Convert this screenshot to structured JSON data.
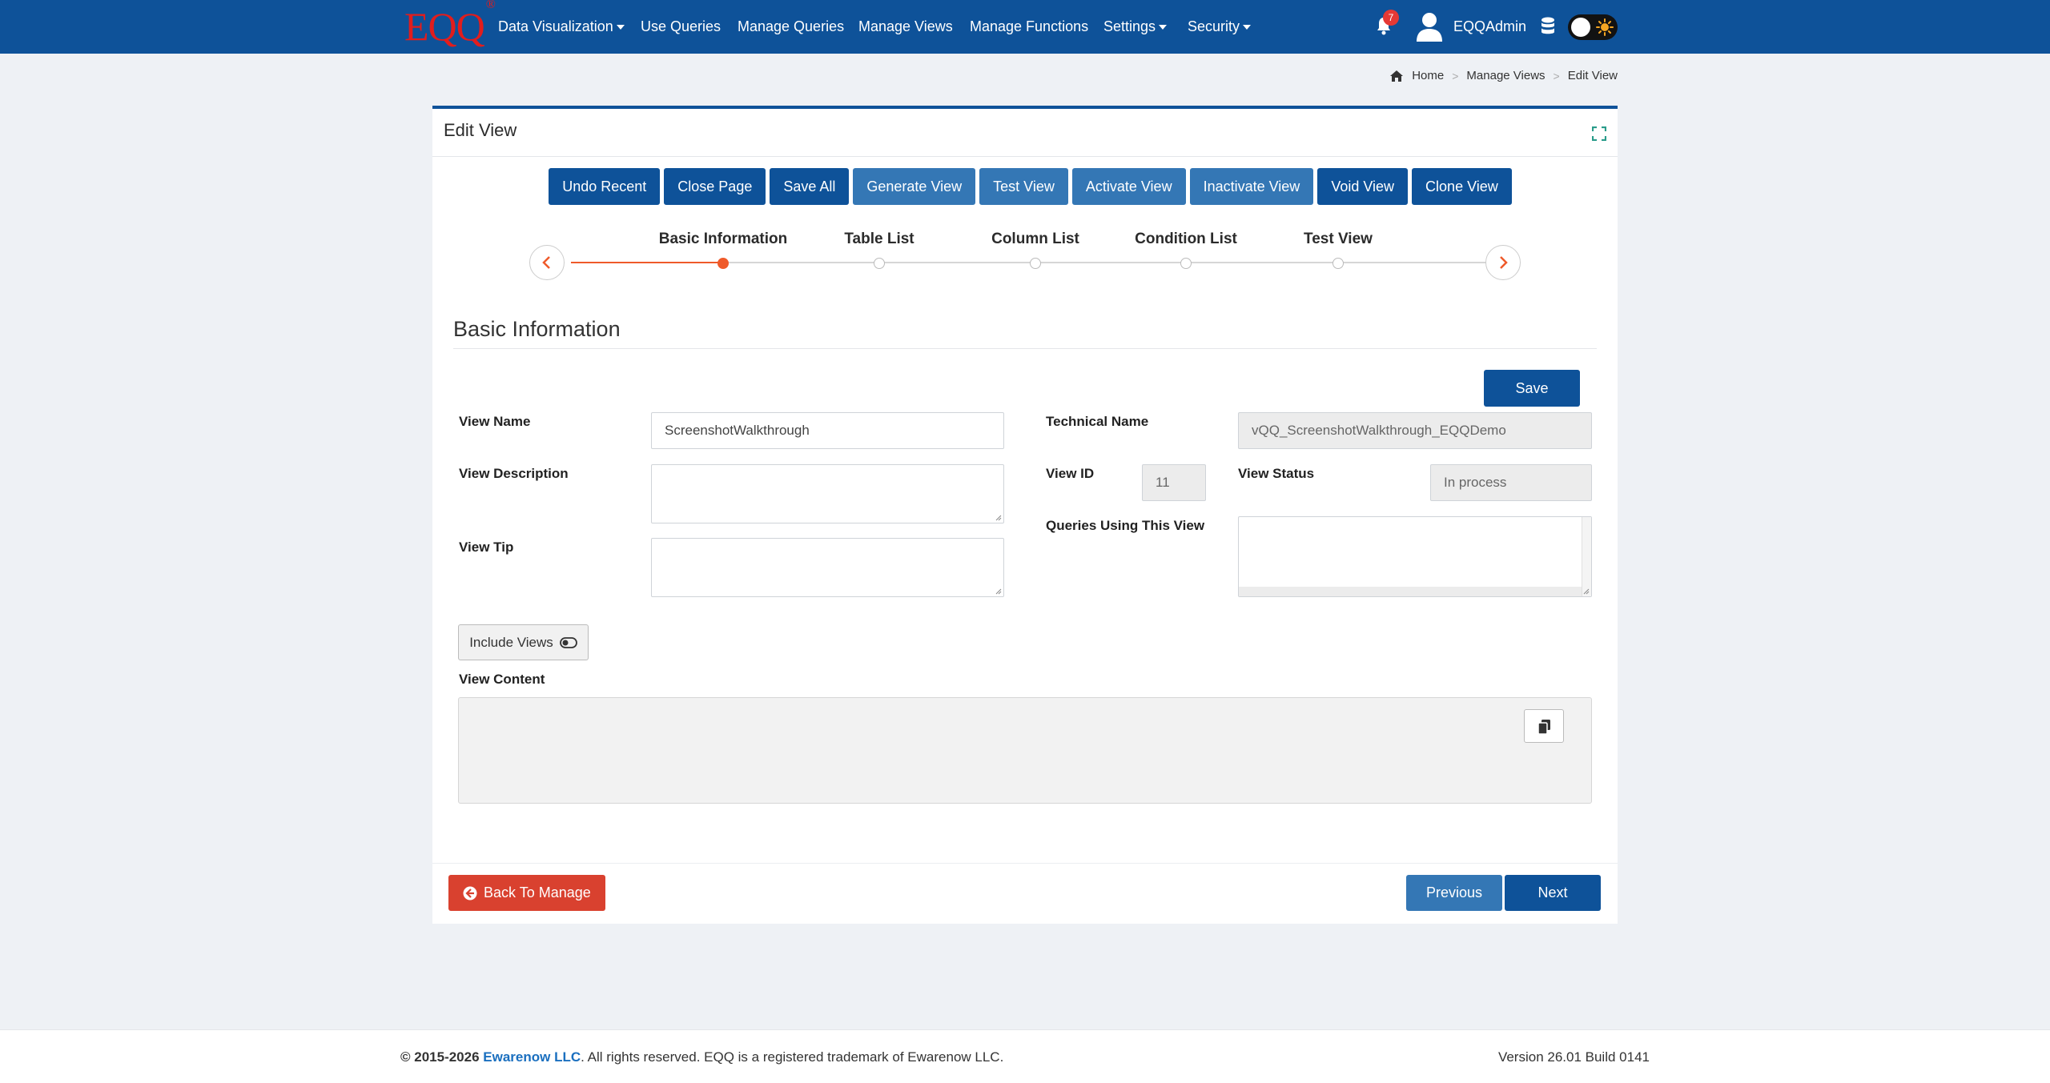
{
  "brand": {
    "logo_text": "EQQ",
    "logo_mark": "®",
    "logo_color": "#e11d1d",
    "nav_color": "#0e5299"
  },
  "nav": {
    "items": [
      {
        "label": "Data Visualization",
        "has_caret": true
      },
      {
        "label": "Use Queries",
        "has_caret": false
      },
      {
        "label": "Manage Queries",
        "has_caret": false
      },
      {
        "label": "Manage Views",
        "has_caret": false
      },
      {
        "label": "Manage Functions",
        "has_caret": false
      },
      {
        "label": "Settings",
        "has_caret": true
      },
      {
        "label": "Security",
        "has_caret": true
      }
    ],
    "notification_count": "7",
    "username": "EQQAdmin",
    "icons": [
      "bell-icon",
      "user-avatar-icon",
      "database-icon",
      "sun-icon"
    ]
  },
  "breadcrumb": {
    "home": "Home",
    "parent": "Manage Views",
    "current": "Edit View"
  },
  "card": {
    "title": "Edit View"
  },
  "toolbar": {
    "undo_recent": "Undo Recent",
    "close_page": "Close Page",
    "save_all": "Save All",
    "generate_view": "Generate View",
    "test_view": "Test View",
    "activate_view": "Activate View",
    "inactivate_view": "Inactivate View",
    "void_view": "Void View",
    "clone_view": "Clone View"
  },
  "stepper": {
    "steps": [
      "Basic Information",
      "Table List",
      "Column List",
      "Condition List",
      "Test View"
    ],
    "active_index": 0,
    "accent_color": "#ef5a2a"
  },
  "section": {
    "title": "Basic Information",
    "save": "Save"
  },
  "form": {
    "view_name_label": "View Name",
    "view_name_value": "ScreenshotWalkthrough",
    "technical_name_label": "Technical Name",
    "technical_name_value": "vQQ_ScreenshotWalkthrough_EQQDemo",
    "view_description_label": "View Description",
    "view_id_label": "View ID",
    "view_id_value": "11",
    "view_status_label": "View Status",
    "view_status_value": "In process",
    "view_tip_label": "View Tip",
    "queries_label": "Queries Using This View",
    "include_views": "Include Views",
    "view_content_label": "View Content"
  },
  "footer_nav": {
    "back": "Back To Manage",
    "previous": "Previous",
    "next": "Next"
  },
  "footer": {
    "years": "© 2015-2026",
    "company": "Ewarenow LLC",
    "rest": ". All rights reserved. EQQ is a registered trademark of Ewarenow LLC.",
    "version": "Version 26.01 Build 0141"
  }
}
